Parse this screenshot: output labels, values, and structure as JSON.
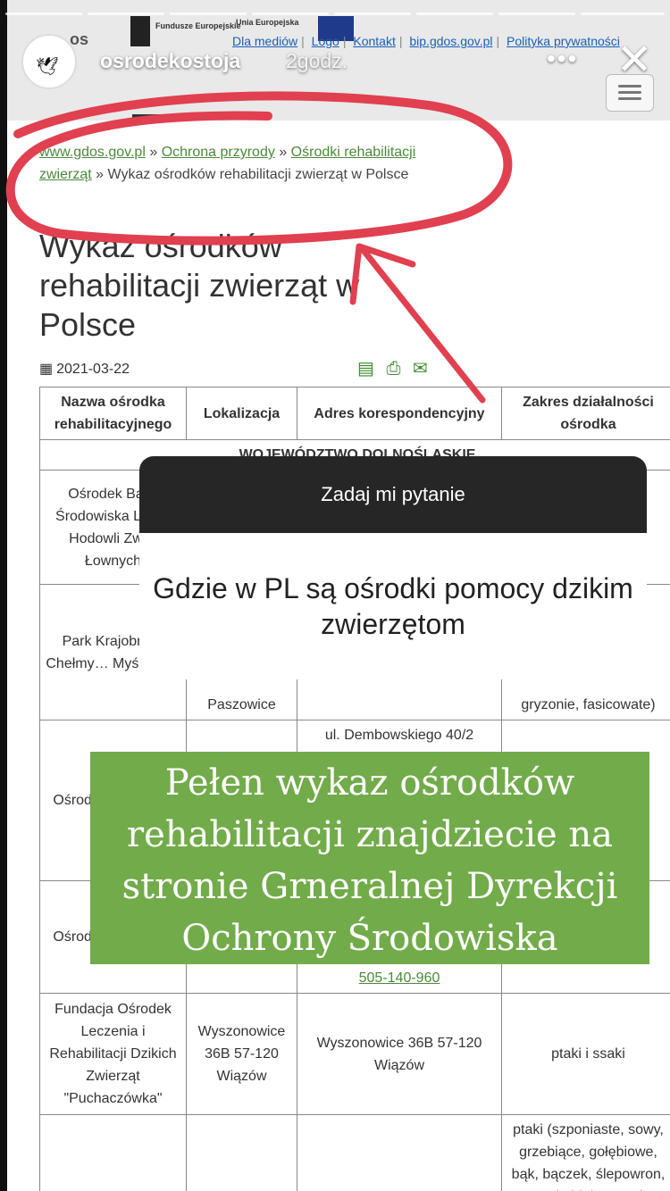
{
  "story": {
    "username": "osrodekostoja",
    "time": "2godz.",
    "more_label": "•••",
    "close_label": "✕",
    "question_sticker": {
      "header": "Zadaj mi pytanie",
      "question": "Gdzie w PL są ośrodki pomocy dzikim zwierzętom"
    },
    "caption": "Pełen wykaz ośrodków rehabilitacji znajdziecie na stronie Grneralnej Dyrekcji Ochrony Środowiska"
  },
  "website": {
    "logo_text": "os",
    "eu_funds_text": "Fundusze Europejskie",
    "eu_union_text": "Unia Europejska",
    "top_links": [
      "Dla mediów",
      "Logo",
      "Kontakt",
      "bip.gdos.gov.pl",
      "Polityka prywatności"
    ],
    "breadcrumb": {
      "links": [
        "www.gdos.gov.pl",
        "Ochrona przyrody",
        "Ośrodki rehabilitacji zwierząt"
      ],
      "separator": "»",
      "current": "Wykaz ośrodków rehabilitacji zwierząt w Polsce"
    },
    "title": "Wykaz ośrodków rehabilitacji zwierząt w Polsce",
    "date": "2021-03-22",
    "table": {
      "headers": [
        "Nazwa ośrodka rehabilitacyjnego",
        "Lokalizacja",
        "Adres korespondencyjny",
        "Zakres działalności ośrodka"
      ],
      "region": "WOJEWÓDZTWO DOLNOŚLĄSKIE",
      "rows": [
        [
          "Ośrodek Ba… Środowiska Le… i Hodowli Zw… Łownych",
          "",
          "",
          ""
        ],
        [
          "Park Krajobra… Chełmy… Myślibor…",
          "Paszowice",
          "",
          "gryzonie, fasicowate)"
        ],
        [
          "Ośrodek… zwier…",
          "",
          "ul. Dembowskiego 40/2",
          ""
        ],
        [
          "Ośrode… zwierz…",
          "",
          "505-140-960",
          ""
        ],
        [
          "Fundacja Ośrodek Leczenia i Rehabilitacji Dzikich Zwierząt \"Puchaczówka\"",
          "Wyszonowice 36B 57-120 Wiązów",
          "Wyszonowice 36B 57-120 Wiązów",
          "ptaki i ssaki"
        ],
        [
          "",
          "",
          "",
          "ptaki (szponiaste, sowy, grzebiące, gołębiowe, bąk, bączek, ślepowron, czapla biała, czapla"
        ]
      ]
    }
  },
  "colors": {
    "annotation": "#e0404f",
    "caption_bg": "#72ab4a",
    "link": "#4a8a3a"
  }
}
